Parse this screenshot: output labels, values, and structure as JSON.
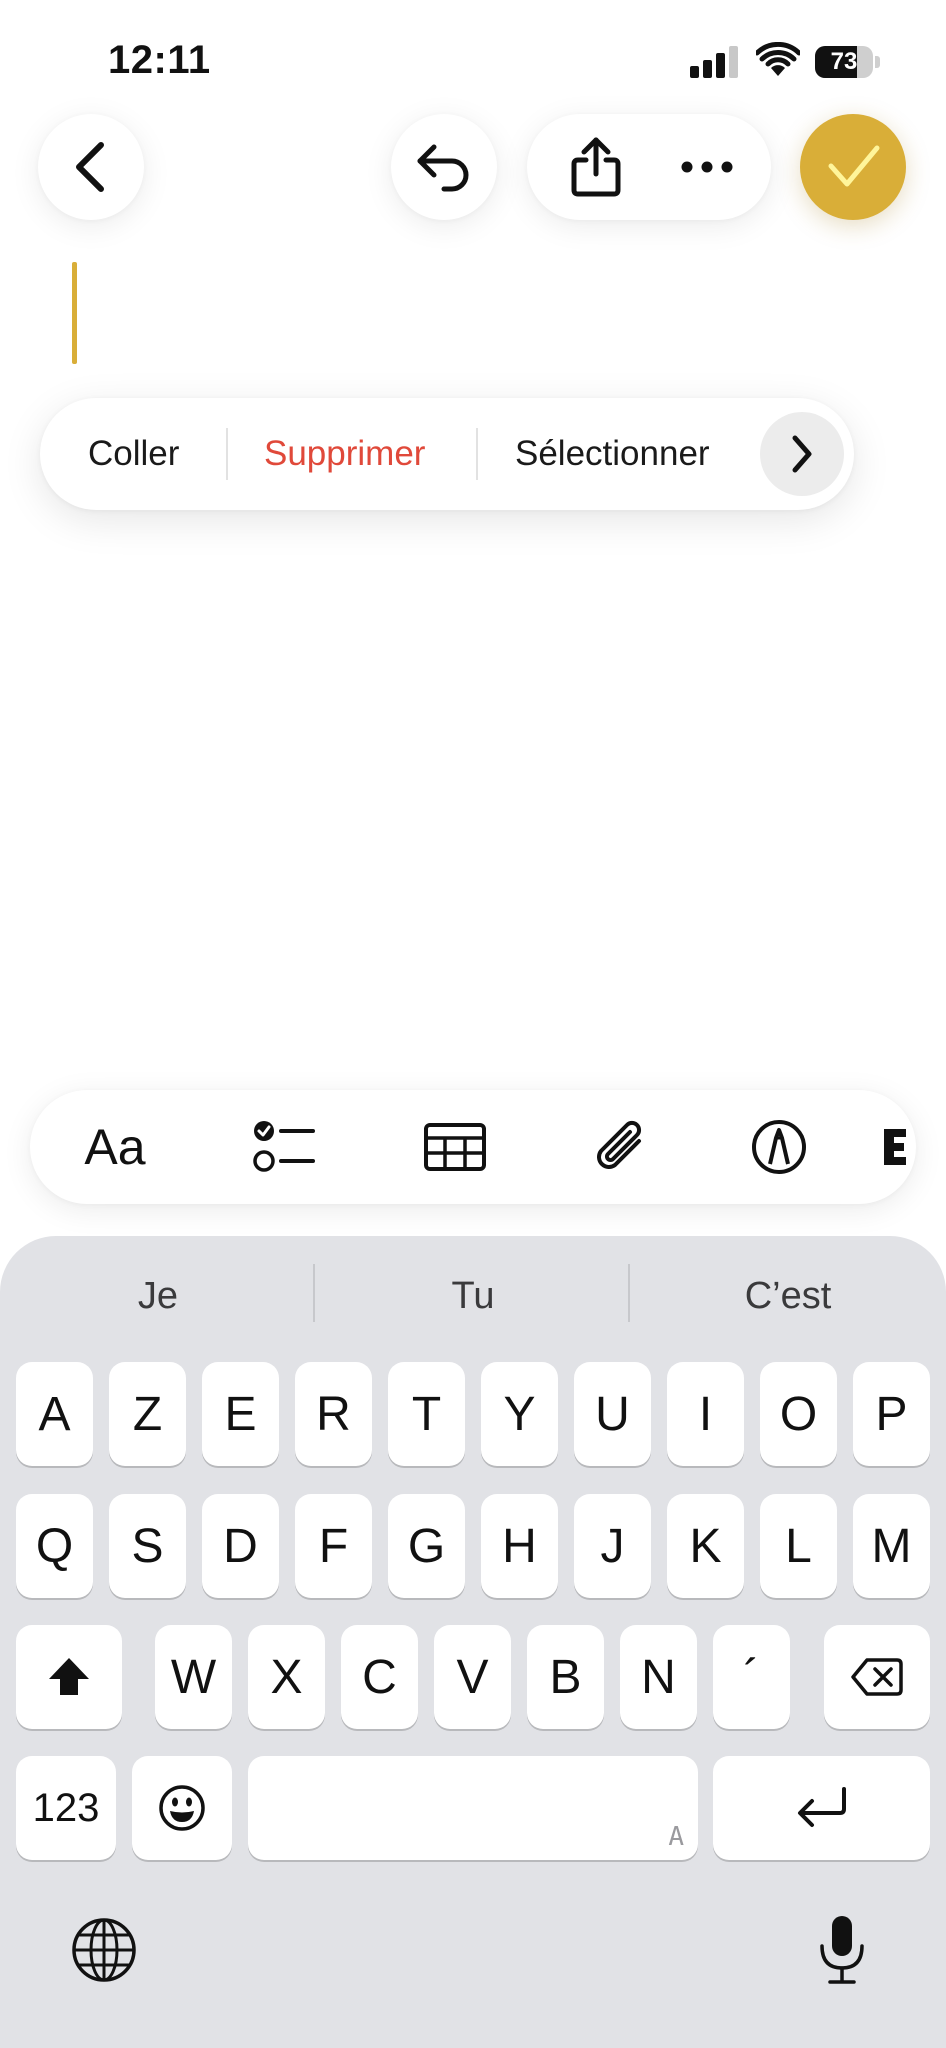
{
  "status_bar": {
    "time": "12:11",
    "battery_level": "73",
    "battery_fraction": 0.73
  },
  "toolbar": {
    "back_icon": "chevron-left-icon",
    "undo_icon": "undo-arrow-icon",
    "share_icon": "share-icon",
    "more_icon": "ellipsis-icon",
    "done_icon": "checkmark-icon",
    "accent_color": "#d9ae38"
  },
  "edit_menu": {
    "items": [
      {
        "label": "Coller",
        "color": "#1a1a1a"
      },
      {
        "label": "Supprimer",
        "color": "#e0493a"
      },
      {
        "label": "Sélectionner",
        "color": "#1a1a1a"
      }
    ],
    "more_icon": "chevron-right-icon"
  },
  "format_bar": {
    "text_style_label": "Aa",
    "icons": [
      "text-style-icon",
      "checklist-icon",
      "table-icon",
      "paperclip-icon",
      "markup-pen-icon",
      "apple-intelligence-icon"
    ]
  },
  "keyboard": {
    "suggestions": [
      "Je",
      "Tu",
      "C’est"
    ],
    "row1": [
      "A",
      "Z",
      "E",
      "R",
      "T",
      "Y",
      "U",
      "I",
      "O",
      "P"
    ],
    "row2": [
      "Q",
      "S",
      "D",
      "F",
      "G",
      "H",
      "J",
      "K",
      "L",
      "M"
    ],
    "row3": [
      "W",
      "X",
      "C",
      "V",
      "B",
      "N",
      "´"
    ],
    "numbers_label": "123",
    "space_hint": "A",
    "shift_icon": "shift-arrow-icon",
    "delete_icon": "delete-backspace-icon",
    "emoji_icon": "emoji-smiley-icon",
    "return_icon": "return-arrow-icon",
    "globe_icon": "globe-icon",
    "mic_icon": "microphone-icon"
  }
}
